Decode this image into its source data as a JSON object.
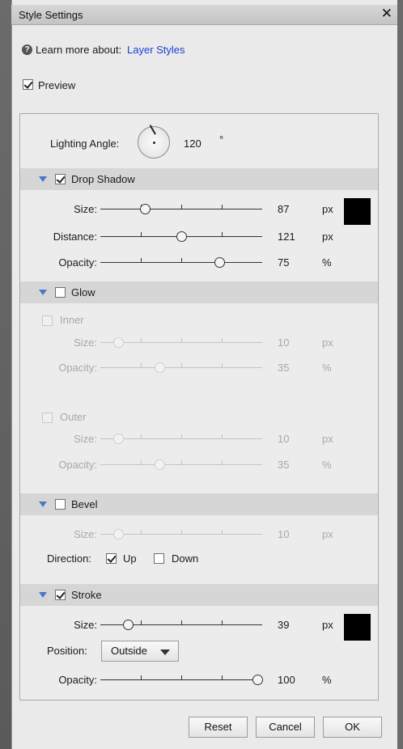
{
  "window": {
    "title": "Style Settings",
    "close_glyph": "✕"
  },
  "learn_more": {
    "text": "Learn more about:",
    "link": "Layer Styles",
    "icon": "question-icon"
  },
  "preview": {
    "label": "Preview",
    "checked": true
  },
  "lighting": {
    "label": "Lighting Angle:",
    "value": "120",
    "unit": "°"
  },
  "drop_shadow": {
    "title": "Drop Shadow",
    "checked": true,
    "size": {
      "label": "Size:",
      "value": "87",
      "unit": "px"
    },
    "distance": {
      "label": "Distance:",
      "value": "121",
      "unit": "px"
    },
    "opacity": {
      "label": "Opacity:",
      "value": "75",
      "unit": "%"
    },
    "color": "#000000"
  },
  "glow": {
    "title": "Glow",
    "checked": false,
    "inner": {
      "label": "Inner",
      "checked": false,
      "size": {
        "label": "Size:",
        "value": "10",
        "unit": "px"
      },
      "opacity": {
        "label": "Opacity:",
        "value": "35",
        "unit": "%"
      }
    },
    "outer": {
      "label": "Outer",
      "checked": false,
      "size": {
        "label": "Size:",
        "value": "10",
        "unit": "px"
      },
      "opacity": {
        "label": "Opacity:",
        "value": "35",
        "unit": "%"
      }
    }
  },
  "bevel": {
    "title": "Bevel",
    "checked": false,
    "size": {
      "label": "Size:",
      "value": "10",
      "unit": "px"
    },
    "direction": {
      "label": "Direction:",
      "up": "Up",
      "up_checked": true,
      "down": "Down",
      "down_checked": false
    }
  },
  "stroke": {
    "title": "Stroke",
    "checked": true,
    "size": {
      "label": "Size:",
      "value": "39",
      "unit": "px"
    },
    "position": {
      "label": "Position:",
      "selected": "Outside"
    },
    "opacity": {
      "label": "Opacity:",
      "value": "100",
      "unit": "%"
    },
    "color": "#000000"
  },
  "buttons": {
    "reset": "Reset",
    "cancel": "Cancel",
    "ok": "OK"
  },
  "colors": {
    "accent_link": "#1a3fd6",
    "triangle": "#4a78c8",
    "section_bg": "#d6d6d6"
  }
}
